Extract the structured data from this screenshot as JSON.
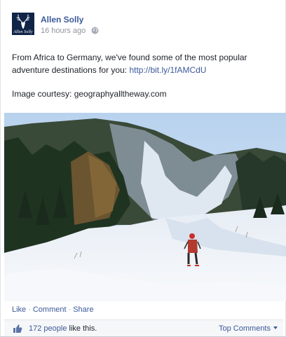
{
  "post": {
    "author": "Allen Solly",
    "avatar_text": "Allen Solly",
    "timestamp": "16 hours ago",
    "privacy_icon": "globe-icon",
    "message_line": "From Africa to Germany, we've found some of the most popular adventure destinations for you: ",
    "message_link": "http://bit.ly/1fAMCdU",
    "courtesy": "Image courtesy: geographyalltheway.com"
  },
  "actions": {
    "like": "Like",
    "comment": "Comment",
    "share": "Share",
    "separator": "·"
  },
  "likes": {
    "icon": "thumbs-up-icon",
    "count_text": "172 people",
    "suffix": " like this.",
    "top_comments": "Top Comments"
  },
  "colors": {
    "link": "#3b5998",
    "avatar_bg": "#0f2447",
    "muted": "#90949c"
  }
}
